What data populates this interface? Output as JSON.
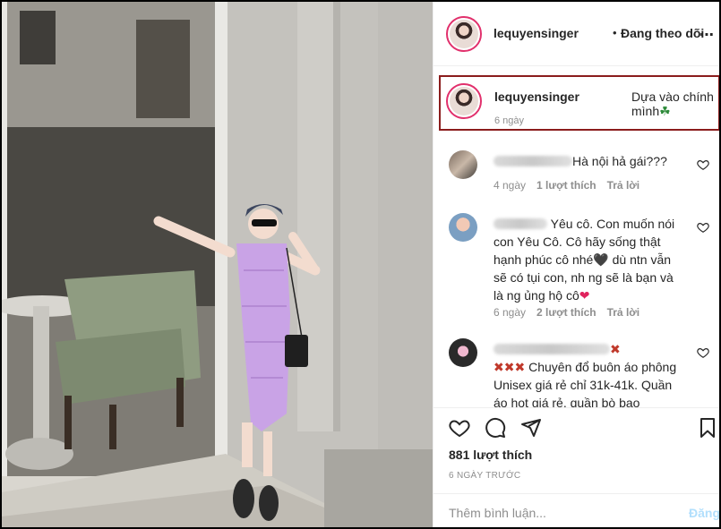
{
  "header": {
    "username": "lequyensinger",
    "separator": "•",
    "follow_status": "Đang theo dõi",
    "more_icon": "more-horizontal-icon"
  },
  "caption": {
    "username": "lequyensinger",
    "text": "Dựa vào chính mình",
    "emoji": "☘",
    "time": "6 ngày"
  },
  "comments": [
    {
      "text": "Hà nội hả gái???",
      "time": "4 ngày",
      "likes": "1 lượt thích",
      "reply": "Trả lời"
    },
    {
      "text": "Yêu cô. Con muốn nói con Yêu Cô. Cô hãy sống thật hạnh phúc cô nhé🖤 dù ntn vẫn sẽ có tụi con, nh ng sẽ là bạn và là ng ủng hộ cô",
      "heart": "❤",
      "time": "6 ngày",
      "likes": "2 lượt thích",
      "reply": "Trả lời"
    },
    {
      "prefix_marks": "✖✖✖",
      "trail_mark": "✖",
      "text": "Chuyên đổ buôn áo phông Unisex giá rẻ chỉ 31k-41k. Quần áo hot giá rẻ, quần bò bao"
    }
  ],
  "actions": {
    "like_icon": "heart-outline-icon",
    "comment_icon": "comment-bubble-icon",
    "share_icon": "send-icon",
    "save_icon": "bookmark-icon",
    "likes": "881 lượt thích",
    "posted": "6 NGÀY TRƯỚC"
  },
  "add_comment": {
    "placeholder": "Thêm bình luận...",
    "post_label": "Đăng"
  },
  "colors": {
    "accent_blue_disabled": "#b2dffc",
    "muted_text": "#8e8e8e",
    "caption_highlight_border": "#8b1c1c",
    "dress": "#c9a3e6"
  }
}
